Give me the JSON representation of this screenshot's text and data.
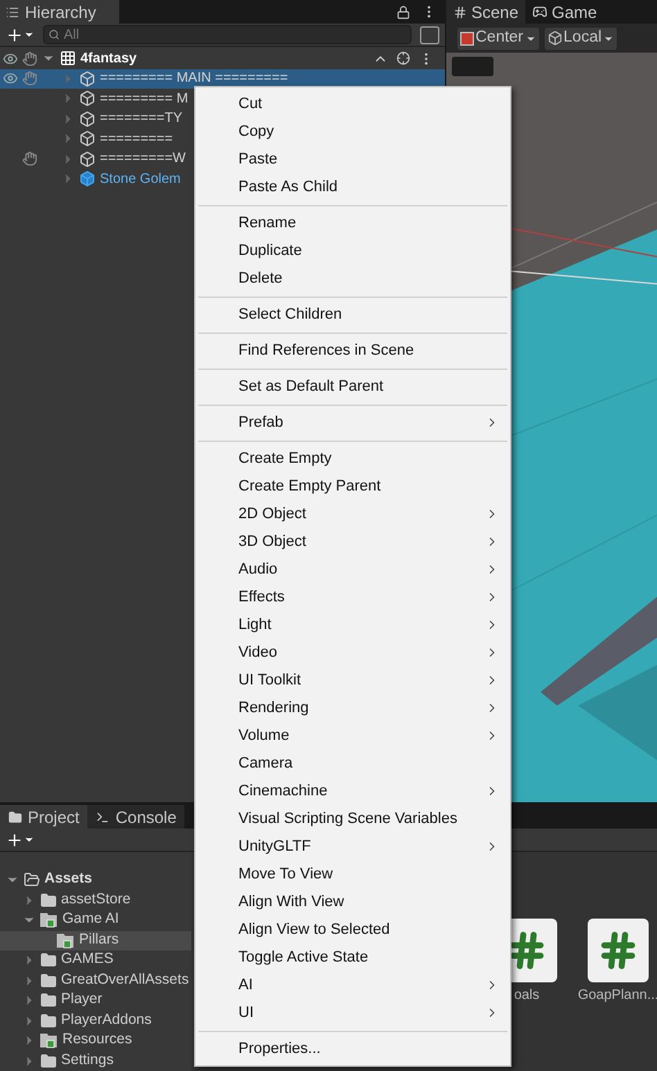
{
  "hierarchy": {
    "tab": "Hierarchy",
    "search": {
      "placeholder": "All"
    },
    "root": {
      "label": "4fantasy",
      "kind": "scene",
      "expanded": true,
      "eye": true,
      "pick_off": true,
      "children": [
        {
          "label": "========= MAIN =========",
          "kind": "object",
          "selected": true,
          "eye": true,
          "pick_off": true
        },
        {
          "label": "========= M",
          "kind": "object",
          "selected": false,
          "eye": false,
          "pick_off": false
        },
        {
          "label": "========TY",
          "kind": "object",
          "selected": false,
          "eye": false,
          "pick_off": false
        },
        {
          "label": "=========",
          "kind": "object",
          "selected": false,
          "eye": false,
          "pick_off": false
        },
        {
          "label": "=========W",
          "kind": "object",
          "selected": false,
          "eye": false,
          "pick_off": true
        },
        {
          "label": "Stone Golem",
          "kind": "prefab",
          "selected": false,
          "eye": false,
          "pick_off": false
        }
      ]
    }
  },
  "scene": {
    "tabs": [
      {
        "label": "Scene",
        "kind": "scene",
        "selected": true
      },
      {
        "label": "Game",
        "kind": "game",
        "selected": false
      }
    ],
    "toolbar": [
      {
        "label": "Center",
        "kind": "pivot"
      },
      {
        "label": "Local",
        "kind": "space"
      }
    ]
  },
  "project": {
    "tabs": [
      {
        "label": "Project",
        "kind": "project",
        "selected": true
      },
      {
        "label": "Console",
        "kind": "console",
        "selected": false
      }
    ],
    "tree": [
      {
        "label": "Assets",
        "kind": "open-folder",
        "expanded": true,
        "selected": false,
        "children": [
          {
            "label": "assetStore",
            "kind": "folder",
            "expanded": false,
            "selected": false
          },
          {
            "label": "Game AI",
            "kind": "special-folder",
            "expanded": true,
            "selected": false,
            "children": [
              {
                "label": "Pillars",
                "kind": "special-folder",
                "selected": true
              }
            ]
          },
          {
            "label": "GAMES",
            "kind": "folder",
            "expanded": false,
            "selected": false
          },
          {
            "label": "GreatOverAllAssets",
            "kind": "folder",
            "expanded": false,
            "selected": false
          },
          {
            "label": "Player",
            "kind": "folder",
            "expanded": false,
            "selected": false
          },
          {
            "label": "PlayerAddons",
            "kind": "folder",
            "expanded": false,
            "selected": false
          },
          {
            "label": "Resources",
            "kind": "special-folder",
            "expanded": false,
            "selected": false
          },
          {
            "label": "Settings",
            "kind": "folder",
            "expanded": false,
            "selected": false
          }
        ]
      }
    ],
    "files": [
      {
        "label": "oals"
      },
      {
        "label": "GoapPlann..."
      }
    ]
  },
  "menu": {
    "groups": [
      [
        {
          "label": "Cut",
          "submenu": false
        },
        {
          "label": "Copy",
          "submenu": false
        },
        {
          "label": "Paste",
          "submenu": false
        },
        {
          "label": "Paste As Child",
          "submenu": false
        }
      ],
      [
        {
          "label": "Rename",
          "submenu": false
        },
        {
          "label": "Duplicate",
          "submenu": false
        },
        {
          "label": "Delete",
          "submenu": false
        }
      ],
      [
        {
          "label": "Select Children",
          "submenu": false
        }
      ],
      [
        {
          "label": "Find References in Scene",
          "submenu": false
        }
      ],
      [
        {
          "label": "Set as Default Parent",
          "submenu": false
        }
      ],
      [
        {
          "label": "Prefab",
          "submenu": true
        }
      ],
      [
        {
          "label": "Create Empty",
          "submenu": false
        },
        {
          "label": "Create Empty Parent",
          "submenu": false
        },
        {
          "label": "2D Object",
          "submenu": true
        },
        {
          "label": "3D Object",
          "submenu": true
        },
        {
          "label": "Audio",
          "submenu": true
        },
        {
          "label": "Effects",
          "submenu": true
        },
        {
          "label": "Light",
          "submenu": true
        },
        {
          "label": "Video",
          "submenu": true
        },
        {
          "label": "UI Toolkit",
          "submenu": true
        },
        {
          "label": "Rendering",
          "submenu": true
        },
        {
          "label": "Volume",
          "submenu": true
        },
        {
          "label": "Camera",
          "submenu": false
        },
        {
          "label": "Cinemachine",
          "submenu": true
        },
        {
          "label": "Visual Scripting Scene Variables",
          "submenu": false
        },
        {
          "label": "UnityGLTF",
          "submenu": true
        },
        {
          "label": "Move To View",
          "submenu": false
        },
        {
          "label": "Align With View",
          "submenu": false
        },
        {
          "label": "Align View to Selected",
          "submenu": false
        },
        {
          "label": "Toggle Active State",
          "submenu": false
        },
        {
          "label": "AI",
          "submenu": true
        },
        {
          "label": "UI",
          "submenu": true
        }
      ],
      [
        {
          "label": "Properties...",
          "submenu": false
        }
      ]
    ]
  }
}
